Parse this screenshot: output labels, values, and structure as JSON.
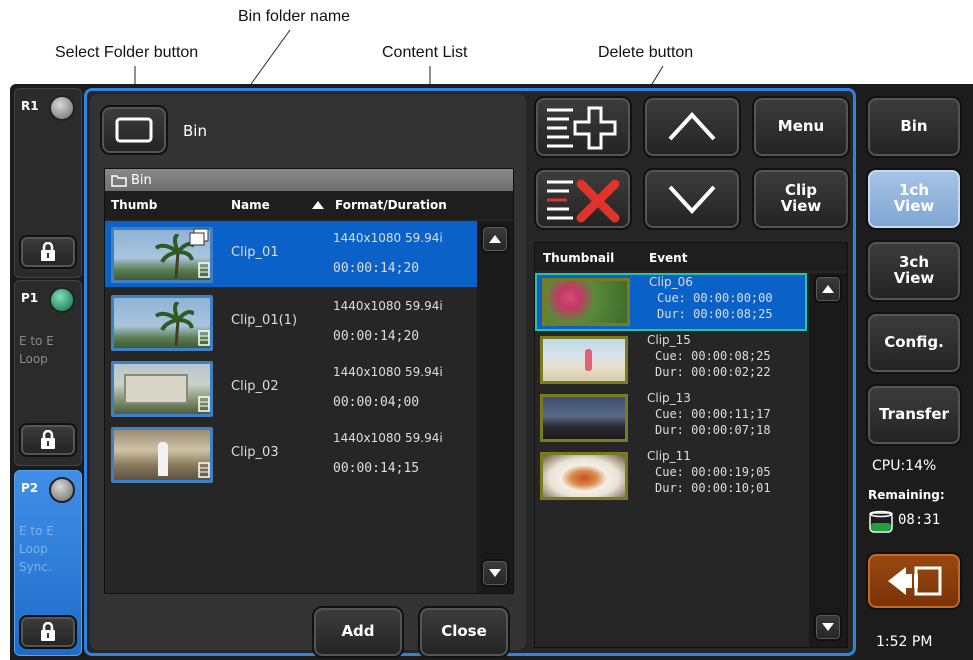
{
  "annotations": {
    "bin_folder_name": "Bin folder name",
    "select_folder_button": "Select Folder button",
    "content_list": "Content List",
    "delete_button": "Delete button"
  },
  "channels": [
    {
      "id": "R1",
      "label": "R1",
      "led": "#9a9a9a",
      "mode": []
    },
    {
      "id": "P1",
      "label": "P1",
      "led": "#3daa80",
      "mode": [
        "E to E",
        "Loop"
      ]
    },
    {
      "id": "P2",
      "label": "P2",
      "led": "#9a9a9a",
      "mode": [
        "E to E",
        "Loop",
        "Sync."
      ]
    }
  ],
  "bin": {
    "folder_name": "Bin",
    "list_header": "Bin",
    "columns": {
      "thumb": "Thumb",
      "name": "Name",
      "format": "Format/Duration"
    },
    "clips": [
      {
        "name": "Clip_01",
        "format": "1440x1080 59.94i",
        "duration": "00:00:14;20",
        "selected": true,
        "scene": "palm"
      },
      {
        "name": "Clip_01(1)",
        "format": "1440x1080 59.94i",
        "duration": "00:00:14;20",
        "selected": false,
        "scene": "palm"
      },
      {
        "name": "Clip_02",
        "format": "1440x1080 59.94i",
        "duration": "00:00:04;00",
        "selected": false,
        "scene": "sign"
      },
      {
        "name": "Clip_03",
        "format": "1440x1080 59.94i",
        "duration": "00:00:14;15",
        "selected": false,
        "scene": "lobby"
      }
    ],
    "add_label": "Add",
    "close_label": "Close"
  },
  "playlist": {
    "columns": {
      "thumbnail": "Thumbnail",
      "event": "Event"
    },
    "events": [
      {
        "name": "Clip_06",
        "cue": "Cue: 00:00:00;00",
        "dur": "Dur: 00:00:08;25",
        "selected": true,
        "scene": "flowers"
      },
      {
        "name": "Clip_15",
        "cue": "Cue: 00:00:08;25",
        "dur": "Dur: 00:00:02;22",
        "selected": false,
        "scene": "beach"
      },
      {
        "name": "Clip_13",
        "cue": "Cue: 00:00:11;17",
        "dur": "Dur: 00:00:07;18",
        "selected": false,
        "scene": "dusk"
      },
      {
        "name": "Clip_11",
        "cue": "Cue: 00:00:19;05",
        "dur": "Dur: 00:00:10;01",
        "selected": false,
        "scene": "food"
      }
    ]
  },
  "controls": {
    "menu": "Menu",
    "clip_view": "Clip\nView"
  },
  "sidebar": {
    "bin": "Bin",
    "ch1_view": "1ch\nView",
    "ch3_view": "3ch\nView",
    "config": "Config.",
    "transfer": "Transfer",
    "cpu": "CPU:14%",
    "remaining_label": "Remaining:",
    "remaining_value": "08:31",
    "clock": "1:52 PM"
  },
  "colors": {
    "selection": "#0a62c9",
    "highlight_blue": "#2f84e3",
    "active_button": "#8fb3db",
    "back_button": "#8a3a08"
  }
}
